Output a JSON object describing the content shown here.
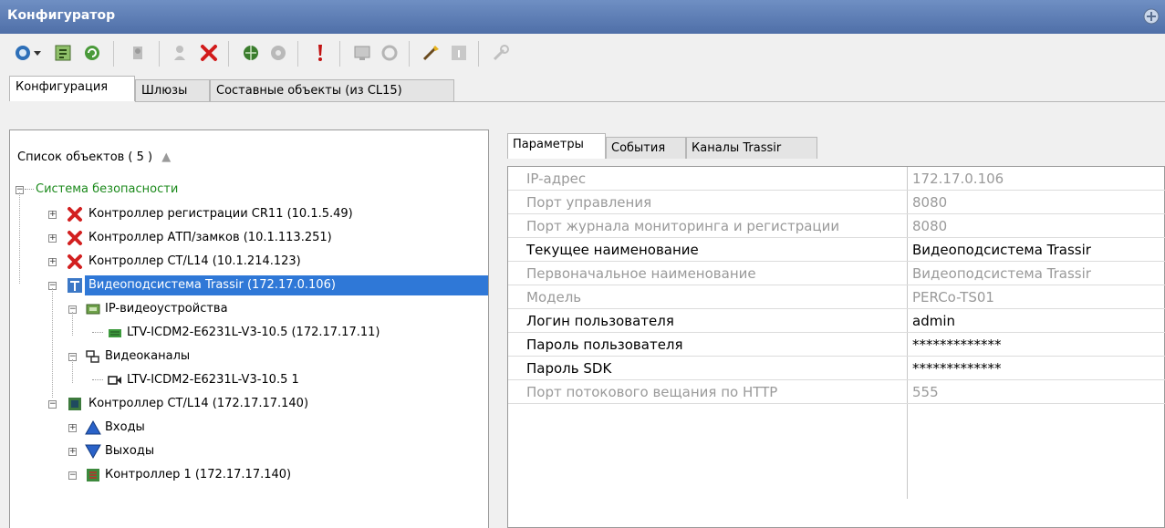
{
  "window": {
    "title": "Конфигуратор"
  },
  "main_tabs": [
    {
      "label": "Конфигурация",
      "active": true
    },
    {
      "label": "Шлюзы",
      "active": false
    },
    {
      "label": "Составные объекты (из CL15)",
      "active": false
    }
  ],
  "object_list": {
    "header": "Список объектов ( 5 )",
    "sort_glyph": "▲",
    "items": [
      {
        "label": "Система безопасности",
        "icon": "none",
        "expand": "−"
      },
      {
        "label": "Контроллер регистрации CR11 (10.1.5.49)",
        "icon": "red-x-icon",
        "expand": "+"
      },
      {
        "label": "Контроллер АТП/замков (10.1.113.251)",
        "icon": "red-x-icon",
        "expand": "+"
      },
      {
        "label": "Контроллер CT/L14 (10.1.214.123)",
        "icon": "red-x-icon",
        "expand": "+"
      },
      {
        "label": "Видеоподсистема Trassir (172.17.0.106)",
        "icon": "trassir-icon",
        "expand": "−",
        "selected": true
      },
      {
        "label": "IP-видеоустройства",
        "icon": "ip-devices-icon",
        "expand": "−"
      },
      {
        "label": "LTV-ICDM2-E6231L-V3-10.5 (172.17.17.11)",
        "icon": "ip-camera-icon",
        "expand": ""
      },
      {
        "label": "Видеоканалы",
        "icon": "video-channels-icon",
        "expand": "−"
      },
      {
        "label": "LTV-ICDM2-E6231L-V3-10.5 1",
        "icon": "camera-channel-icon",
        "expand": ""
      },
      {
        "label": "Контроллер CT/L14 (172.17.17.140)",
        "icon": "controller-icon",
        "expand": "−"
      },
      {
        "label": "Входы",
        "icon": "inputs-icon",
        "expand": "+"
      },
      {
        "label": "Выходы",
        "icon": "outputs-icon",
        "expand": "+"
      },
      {
        "label": "Контроллер 1 (172.17.17.140)",
        "icon": "controller-board-icon",
        "expand": "−"
      }
    ]
  },
  "props_tabs": [
    {
      "label": "Параметры",
      "active": true
    },
    {
      "label": "События",
      "active": false
    },
    {
      "label": "Каналы Trassir",
      "active": false
    }
  ],
  "properties": [
    {
      "name": "IP-адрес",
      "value": "172.17.0.106",
      "enabled": false
    },
    {
      "name": "Порт управления",
      "value": "8080",
      "enabled": false
    },
    {
      "name": "Порт журнала мониторинга и регистрации",
      "value": "8080",
      "enabled": false
    },
    {
      "name": "Текущее наименование",
      "value": "Видеоподсистема Trassir",
      "enabled": true
    },
    {
      "name": "Первоначальное наименование",
      "value": "Видеоподсистема Trassir",
      "enabled": false
    },
    {
      "name": "Модель",
      "value": "PERCo-TS01",
      "enabled": false
    },
    {
      "name": "Логин пользователя",
      "value": "admin",
      "enabled": true
    },
    {
      "name": "Пароль пользователя",
      "value": "*************",
      "enabled": true
    },
    {
      "name": "Пароль SDK",
      "value": "*************",
      "enabled": true
    },
    {
      "name": "Порт потокового вещания по HTTP",
      "value": "555",
      "enabled": false
    }
  ]
}
